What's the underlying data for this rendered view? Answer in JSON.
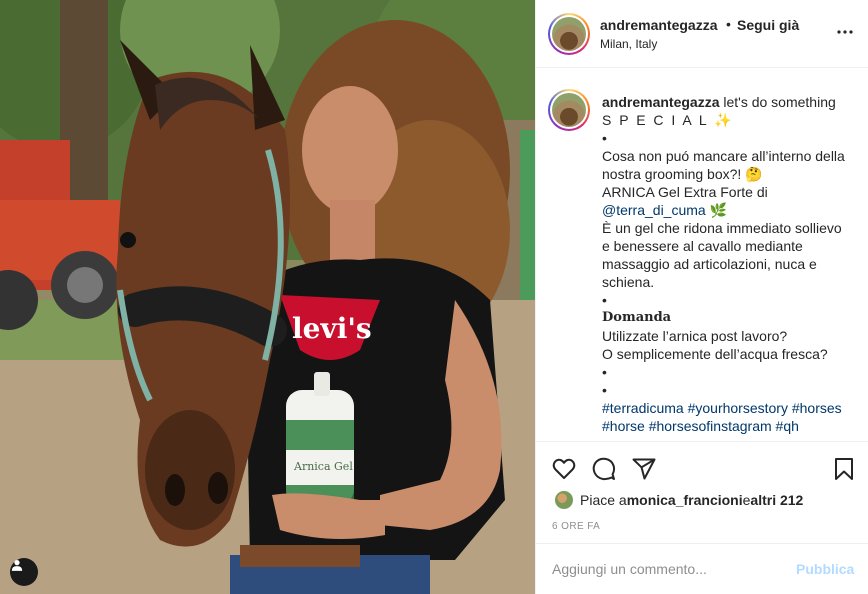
{
  "post": {
    "username": "andremantegazza",
    "separator": "•",
    "follow_status": "Segui già",
    "location": "Milan, Italy",
    "more_icon": "more-horizontal-icon"
  },
  "caption": {
    "username": "andremantegazza",
    "lines": [
      "let's do something",
      "S P E C I A L ✨",
      "•",
      "Cosa non puó mancare all’interno della",
      "nostra grooming box?! 🤔",
      "ARNICA Gel Extra Forte di",
      "@terra_di_cuma 🌿",
      "È un gel che ridona immediato sollievo",
      "e benessere al cavallo mediante",
      "massaggio ad articolazioni, nuca e",
      "schiena.",
      "•",
      "Domanda",
      "Utilizzate l’arnica post lavoro?",
      "O semplicemente dell’acqua fresca?",
      "•",
      "•",
      "#terradicuma #yourhorsestory #horses",
      "#horse #horsesofinstagram #qh"
    ]
  },
  "actions": {
    "like_icon": "heart-icon",
    "comment_icon": "comment-icon",
    "share_icon": "send-icon",
    "save_icon": "bookmark-icon"
  },
  "likes": {
    "prefix": "Piace a ",
    "user": "monica_francioni",
    "middle": " e ",
    "others": "altri 212"
  },
  "timestamp": "6 ORE FA",
  "comment": {
    "placeholder": "Aggiungi un commento...",
    "post_label": "Pubblica"
  },
  "photo": {
    "tag_icon": "user-tag-icon",
    "shirt_text": "levi's",
    "bottle_text": "Arnica Gel"
  },
  "colors": {
    "link": "#00376b",
    "muted": "#8e8e8e",
    "post_disabled": "#b3dbff",
    "shirt_logo": "#c8102e"
  }
}
